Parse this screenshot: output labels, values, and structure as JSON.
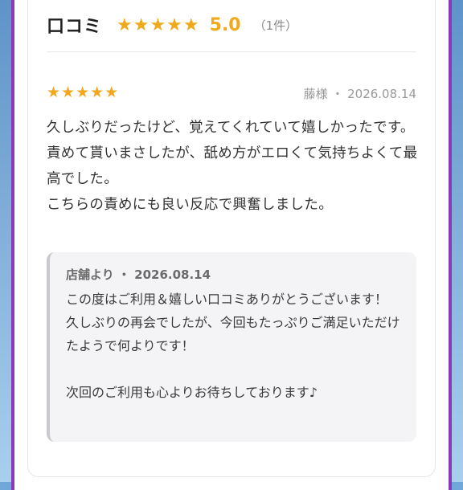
{
  "header": {
    "title": "口コミ",
    "stars": "★★★★★",
    "rating": "5.0",
    "count": "（1件）"
  },
  "review": {
    "stars": "★★★★★",
    "meta": "藤様 ・ 2026.08.14",
    "rating_value": 5,
    "lines": [
      "久しぶりだったけど、覚えてくれていて嬉しかったです。",
      "責めて貰いまさしたが、舐め方がエロくて気持ちよくて最高でした。",
      "こちらの責めにも良い反応で興奮しました。"
    ]
  },
  "reply": {
    "meta": "店舗より ・ 2026.08.14",
    "lines": [
      "この度はご利用＆嬉しい口コミありがとうございます！",
      "久しぶりの再会でしたが、今回もたっぷりご満足いただけたようで何よりです！",
      "",
      "次回のご利用も心よりお待ちしております♪"
    ]
  },
  "colors": {
    "accent_star": "#f0a91b",
    "frame_border": "#8a3ab8",
    "reply_bg": "#f4f4f7"
  }
}
